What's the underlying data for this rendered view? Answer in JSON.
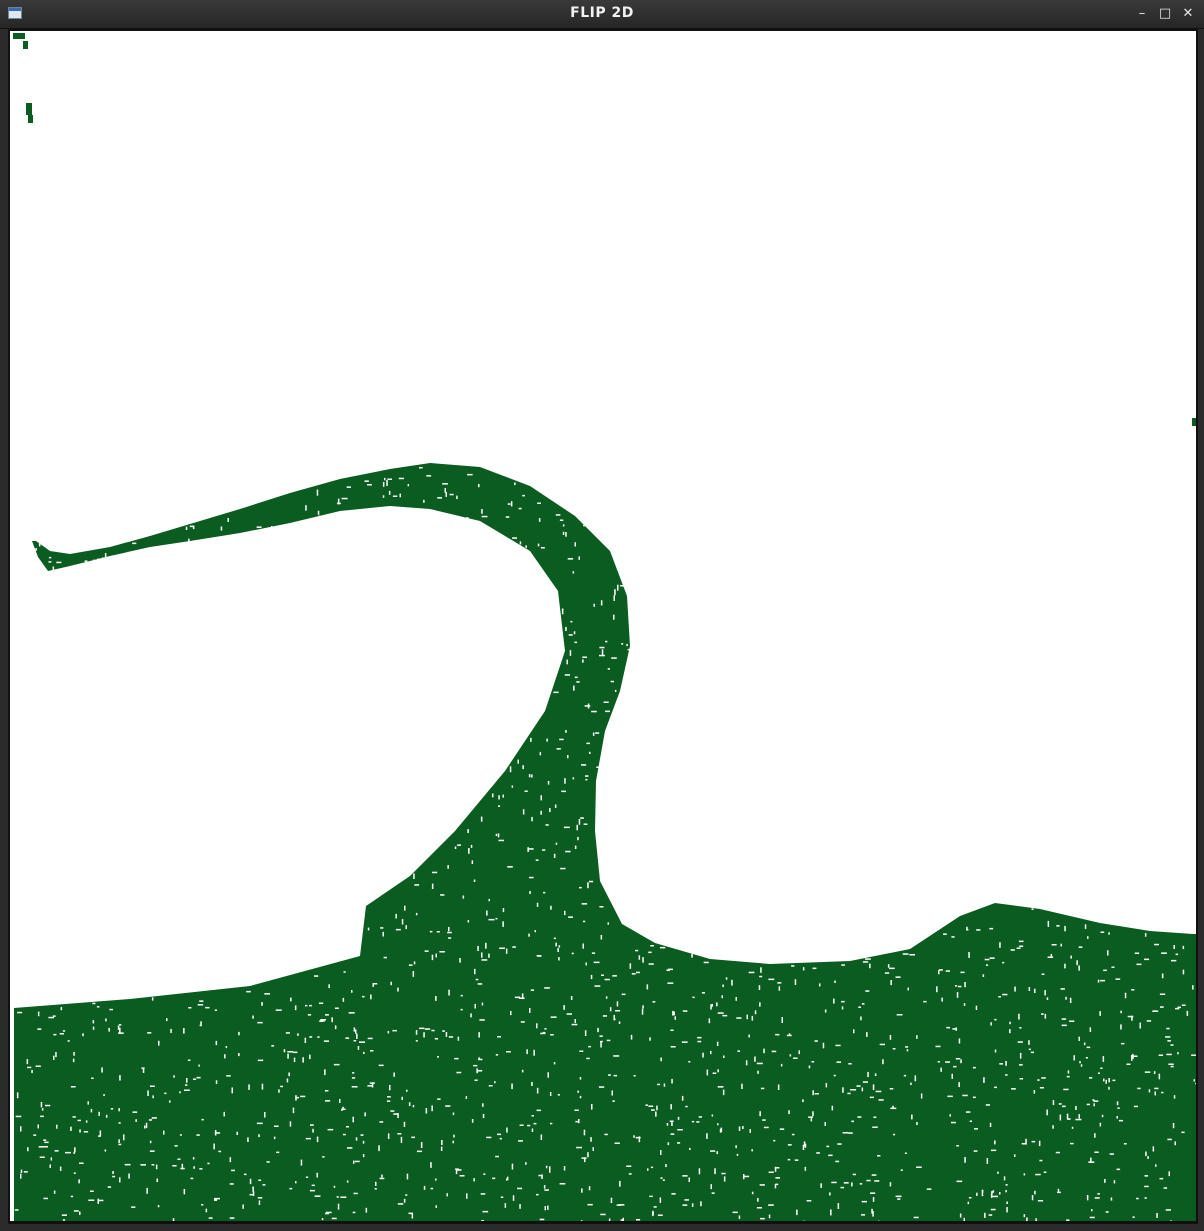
{
  "window": {
    "title": "FLIP 2D",
    "controls": {
      "minimize_glyph": "–",
      "maximize_glyph": "□",
      "close_glyph": "✕"
    }
  },
  "colors": {
    "fluid": "#0b5c21",
    "background": "#ffffff",
    "border": "#141414"
  },
  "icons": [
    "app-window-icon",
    "minimize-icon",
    "maximize-icon",
    "close-icon"
  ]
}
